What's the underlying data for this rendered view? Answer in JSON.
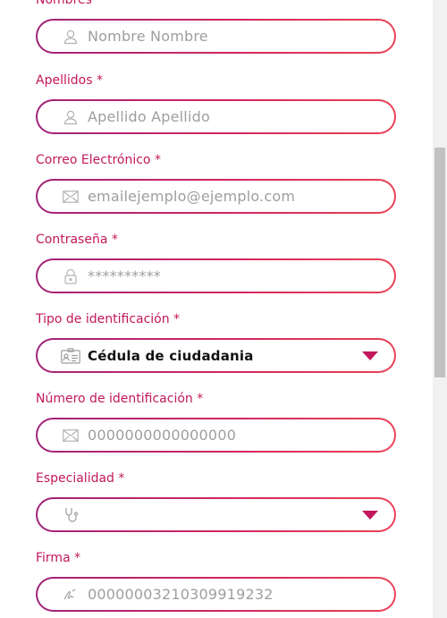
{
  "form": {
    "nombres": {
      "label": "Nombres *",
      "placeholder": "Nombre Nombre",
      "icon": "user-icon"
    },
    "apellidos": {
      "label": "Apellidos *",
      "placeholder": "Apellido Apellido",
      "icon": "user-icon"
    },
    "correo": {
      "label": "Correo Electrónico *",
      "placeholder": "emailejemplo@ejemplo.com",
      "icon": "envelope-icon"
    },
    "contrasena": {
      "label": "Contraseña *",
      "placeholder": "**********",
      "icon": "lock-icon"
    },
    "tipo_id": {
      "label": "Tipo de identificación *",
      "value": "Cédula de ciudadania",
      "icon": "id-card-icon"
    },
    "numero_id": {
      "label": "Número de identificación *",
      "placeholder": "0000000000000000",
      "icon": "envelope-icon"
    },
    "especialidad": {
      "label": "Especialidad *",
      "value": "",
      "icon": "stethoscope-icon"
    },
    "firma": {
      "label": "Firma *",
      "placeholder": "0000000321030991923​2",
      "icon": "signature-icon"
    }
  },
  "colors": {
    "label": "#c2185b",
    "border_start": "#a0237a",
    "border_end": "#ea4257",
    "caret": "#c2185b",
    "placeholder": "#9e9e9e"
  }
}
